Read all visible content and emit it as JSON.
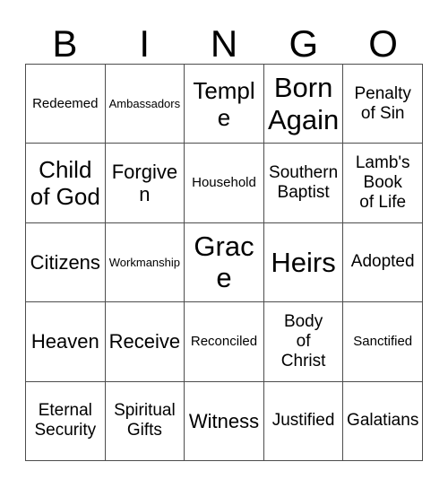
{
  "card": {
    "header_letters": [
      "B",
      "I",
      "N",
      "G",
      "O"
    ],
    "grid_columns": 5,
    "grid_rows": 5,
    "border_color": "#4d4d4d",
    "text_color": "#000000",
    "background_color": "#ffffff",
    "rows": [
      [
        {
          "label": "Redeemed",
          "size": "sm",
          "lines": [
            "Redeemed"
          ]
        },
        {
          "label": "Ambassadors",
          "size": "xs",
          "lines": [
            "Ambassadors"
          ]
        },
        {
          "label": "Temple",
          "size": "xl",
          "lines": [
            "Temple"
          ]
        },
        {
          "label": "Born Again",
          "size": "xxl",
          "lines": [
            "Born",
            "Again"
          ]
        },
        {
          "label": "Penalty of Sin",
          "size": "md",
          "lines": [
            "Penalty",
            "of Sin"
          ]
        }
      ],
      [
        {
          "label": "Child of God",
          "size": "xl",
          "lines": [
            "Child",
            "of God"
          ]
        },
        {
          "label": "Forgiven",
          "size": "lg",
          "lines": [
            "Forgiven"
          ]
        },
        {
          "label": "Household",
          "size": "sm",
          "lines": [
            "Household"
          ]
        },
        {
          "label": "Southern Baptist",
          "size": "md",
          "lines": [
            "Southern",
            "Baptist"
          ]
        },
        {
          "label": "Lamb's Book of Life",
          "size": "md",
          "lines": [
            "Lamb's",
            "Book",
            "of Life"
          ]
        }
      ],
      [
        {
          "label": "Citizens",
          "size": "lg",
          "lines": [
            "Citizens"
          ]
        },
        {
          "label": "Workmanship",
          "size": "xs",
          "lines": [
            "Workmanship"
          ]
        },
        {
          "label": "Grace",
          "size": "xxl",
          "lines": [
            "Grace"
          ]
        },
        {
          "label": "Heirs",
          "size": "xxl",
          "lines": [
            "Heirs"
          ]
        },
        {
          "label": "Adopted",
          "size": "md",
          "lines": [
            "Adopted"
          ]
        }
      ],
      [
        {
          "label": "Heaven",
          "size": "lg",
          "lines": [
            "Heaven"
          ]
        },
        {
          "label": "Receive",
          "size": "lg",
          "lines": [
            "Receive"
          ]
        },
        {
          "label": "Reconciled",
          "size": "sm",
          "lines": [
            "Reconciled"
          ]
        },
        {
          "label": "Body of Christ",
          "size": "md",
          "lines": [
            "Body",
            "of",
            "Christ"
          ]
        },
        {
          "label": "Sanctified",
          "size": "sm",
          "lines": [
            "Sanctified"
          ]
        }
      ],
      [
        {
          "label": "Eternal Security",
          "size": "md",
          "lines": [
            "Eternal",
            "Security"
          ]
        },
        {
          "label": "Spiritual Gifts",
          "size": "md",
          "lines": [
            "Spiritual",
            "Gifts"
          ]
        },
        {
          "label": "Witness",
          "size": "lg",
          "lines": [
            "Witness"
          ]
        },
        {
          "label": "Justified",
          "size": "md",
          "lines": [
            "Justified"
          ]
        },
        {
          "label": "Galatians",
          "size": "md",
          "lines": [
            "Galatians"
          ]
        }
      ]
    ]
  }
}
